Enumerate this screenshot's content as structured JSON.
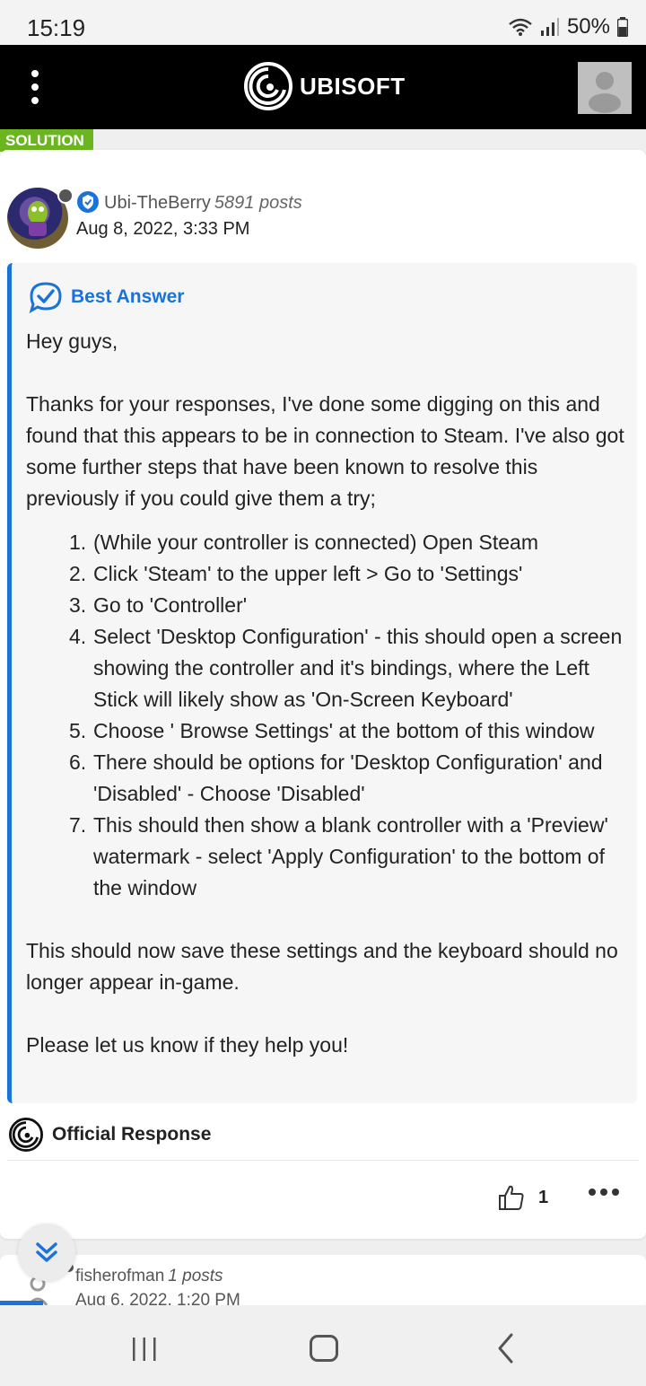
{
  "status_bar": {
    "time": "15:19",
    "battery": "50%"
  },
  "header": {
    "brand": "UBISOFT"
  },
  "post": {
    "solution_tag": "SOLUTION",
    "author": {
      "name": "Ubi-TheBerry",
      "posts": "5891 posts",
      "date": "Aug 8, 2022, 3:33 PM"
    },
    "best_answer_label": "Best Answer",
    "greeting": "Hey guys,",
    "intro": "Thanks for your responses, I've done some digging on this and found that this appears to be in connection to Steam. I've also got some further steps that have been known to resolve this previously if you could give them a try;",
    "steps": [
      "(While your controller is connected) Open Steam",
      "Click 'Steam' to the upper left > Go to 'Settings'",
      "Go to 'Controller'",
      "Select 'Desktop Configuration' - this should open a screen showing the controller and it's bindings, where the Left Stick will likely show as 'On-Screen Keyboard'",
      "Choose ' Browse Settings' at the bottom of this window",
      "There should be options for 'Desktop Configuration' and 'Disabled' - Choose 'Disabled'",
      "This should then show a blank controller with a 'Preview' watermark - select 'Apply Configuration' to the bottom of the window"
    ],
    "outro": "This should now save these settings and the keyboard should no longer appear in-game.",
    "closing": "Please let us know if they help you!",
    "official_label": "Official Response",
    "like_count": "1"
  },
  "next_post": {
    "author_name": "fisherofman",
    "posts": "1 posts",
    "date": "Aug 6, 2022, 1:20 PM"
  },
  "colors": {
    "accent_blue": "#1a73d9",
    "solution_green": "#6bb521",
    "header_black": "#000000"
  },
  "icons": [
    "wifi-icon",
    "signal-icon",
    "battery-icon",
    "menu-dots-icon",
    "ubisoft-logo-icon",
    "user-avatar-icon",
    "verified-badge-icon",
    "best-answer-check-icon",
    "ubisoft-official-icon",
    "thumbs-up-icon",
    "more-dots-icon",
    "chevron-double-down-icon",
    "nav-recents-icon",
    "nav-home-icon",
    "nav-back-icon"
  ]
}
